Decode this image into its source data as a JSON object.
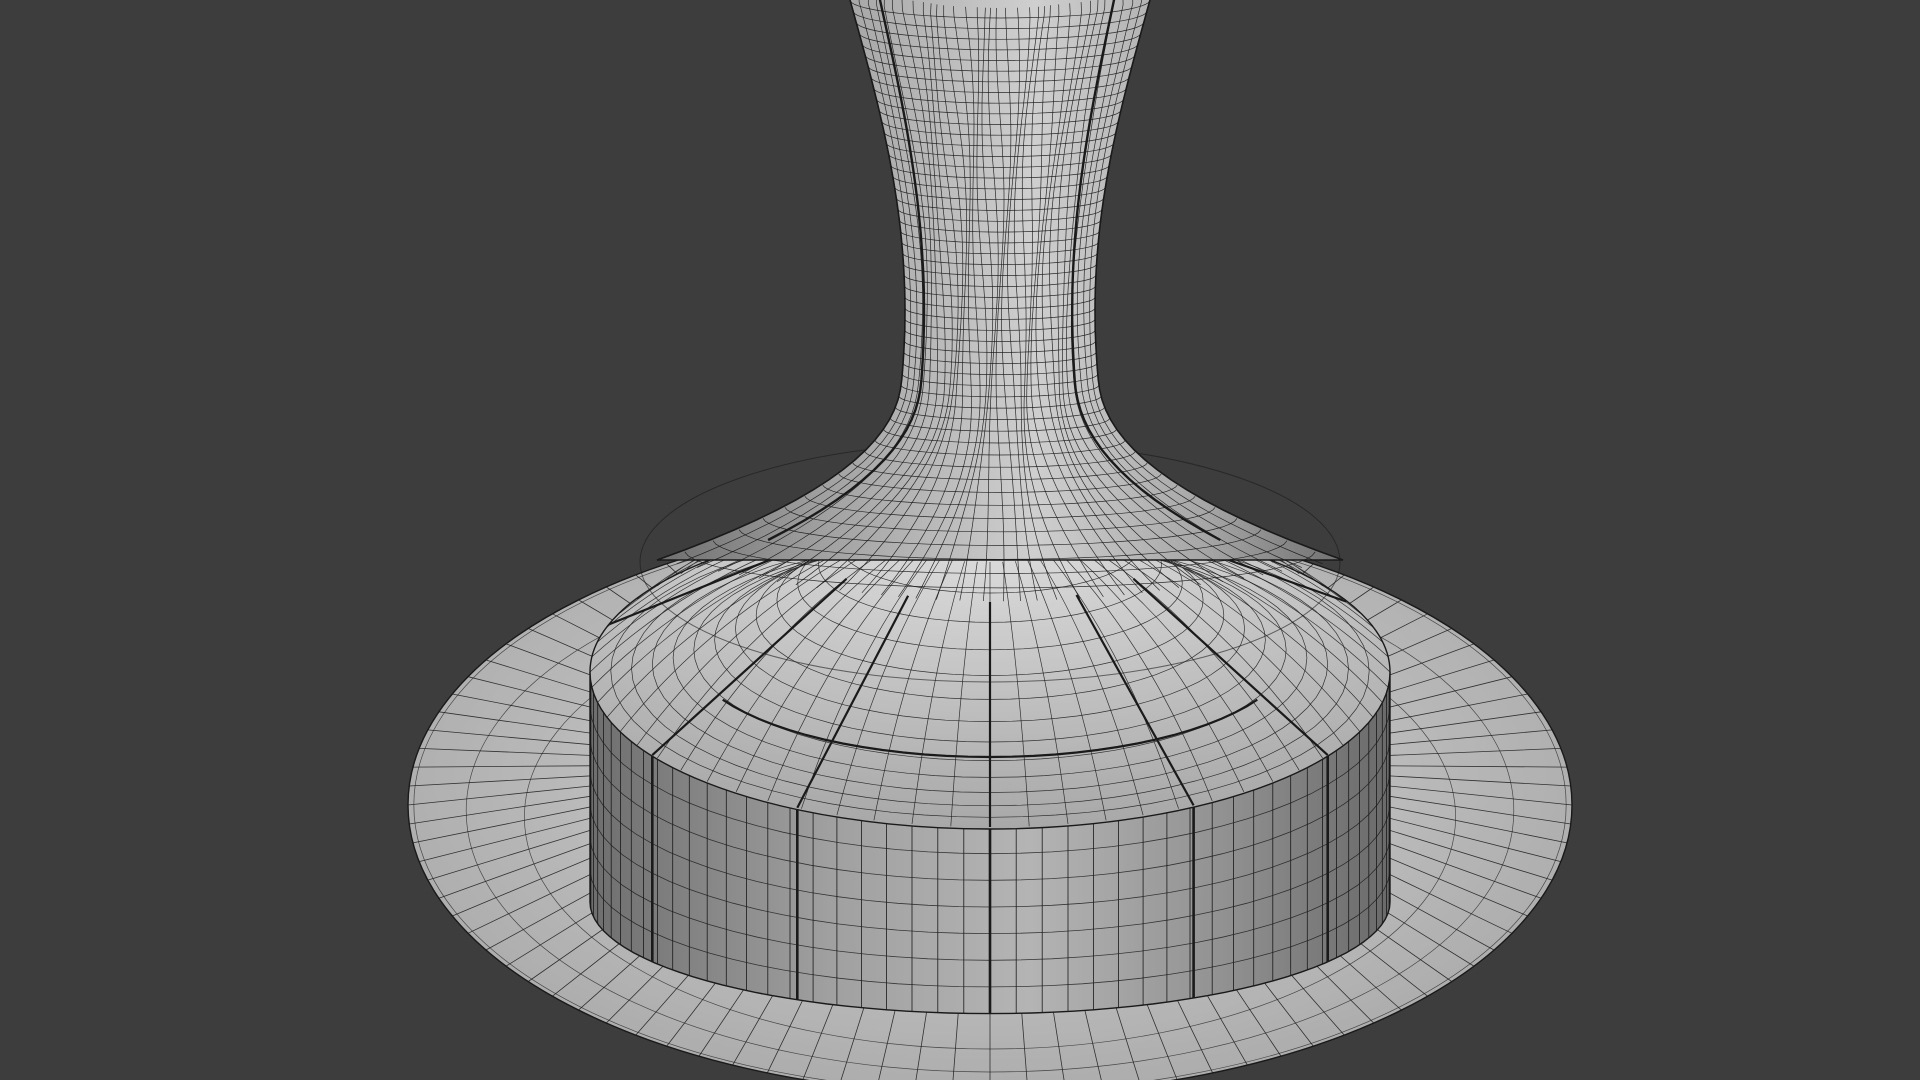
{
  "viewport": {
    "display_mode": "wireframe-on-shaded",
    "subject": "pedestal-mesh",
    "colors": {
      "background": "#3d3d3d",
      "surface_light": "#c8c8c8",
      "surface_mid": "#a9a9a9",
      "surface_dark": "#7e7e7e",
      "wire": "#1a1a1a"
    }
  }
}
